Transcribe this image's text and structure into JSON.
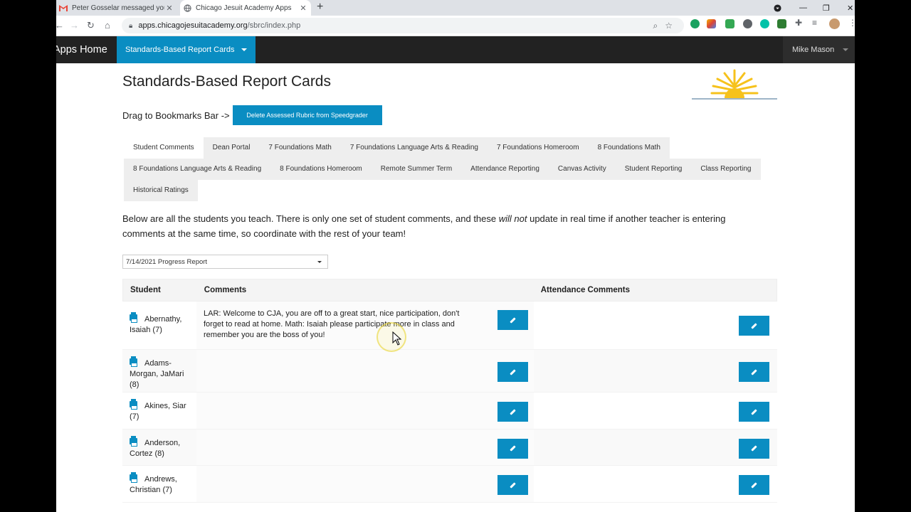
{
  "browser": {
    "tabs": [
      {
        "title": "Peter Gosselar messaged you - C",
        "icon": "gmail-icon"
      },
      {
        "title": "Chicago Jesuit Academy Apps",
        "icon": "globe-icon"
      }
    ],
    "url_host": "apps.chicagojesuitacademy.org",
    "url_path": "/sbrc/index.php"
  },
  "appnav": {
    "brand": "Apps Home",
    "active_section": "Standards-Based Report Cards",
    "user": "Mike Mason"
  },
  "page": {
    "title": "Standards-Based Report Cards",
    "bookmark_label": "Drag to Bookmarks Bar ->",
    "bookmark_button": "Delete Assessed Rubric from Speedgrader",
    "tabs_row1": [
      "Student Comments",
      "Dean Portal",
      "7 Foundations Math",
      "7 Foundations Language Arts & Reading",
      "7 Foundations Homeroom",
      "8 Foundations Math"
    ],
    "tabs_row2": [
      "8 Foundations Language Arts & Reading",
      "8 Foundations Homeroom",
      "Remote Summer Term",
      "Attendance Reporting",
      "Canvas Activity",
      "Student Reporting",
      "Class Reporting"
    ],
    "tabs_row3": [
      "Historical Ratings"
    ],
    "intro_before": "Below are all the students you teach. There is only one set of student comments, and these ",
    "intro_em": "will not",
    "intro_after": " update in real time if another teacher is entering comments at the same time, so coordinate with the rest of your team!",
    "period_select": "7/14/2021 Progress Report"
  },
  "table": {
    "headers": [
      "Student",
      "Comments",
      "Attendance Comments"
    ],
    "rows": [
      {
        "name": "Abernathy, Isaiah (7)",
        "comment": "LAR: Welcome to CJA, you are off to a great start, nice participation, don't forget to read at home. Math: Isaiah please participate more in class and remember you are the boss of you!",
        "attendance": ""
      },
      {
        "name": "Adams-Morgan, JaMari (8)",
        "comment": "",
        "attendance": ""
      },
      {
        "name": "Akines, Siar (7)",
        "comment": "",
        "attendance": ""
      },
      {
        "name": "Anderson, Cortez (8)",
        "comment": "",
        "attendance": ""
      },
      {
        "name": "Andrews, Christian (7)",
        "comment": "",
        "attendance": ""
      }
    ]
  },
  "colors": {
    "accent": "#0a8dc2",
    "navbar": "#222222"
  }
}
